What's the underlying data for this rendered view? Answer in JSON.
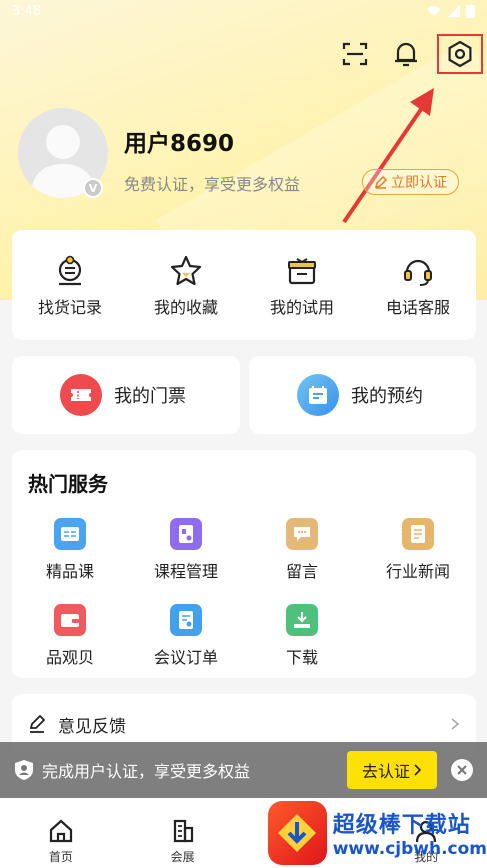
{
  "status_bar": {
    "time": "3:48"
  },
  "user": {
    "name": "用户8690",
    "subtitle": "免费认证，享受更多权益",
    "certify_button": "立即认证",
    "badge": "V"
  },
  "quick_actions": [
    {
      "label": "找货记录",
      "icon": "search-record-icon"
    },
    {
      "label": "我的收藏",
      "icon": "star-icon"
    },
    {
      "label": "我的试用",
      "icon": "gift-box-icon"
    },
    {
      "label": "电话客服",
      "icon": "headset-icon"
    }
  ],
  "tickets": {
    "left_label": "我的门票",
    "right_label": "我的预约"
  },
  "services": {
    "title": "热门服务",
    "items": [
      {
        "label": "精品课",
        "color": "#4aa3f0"
      },
      {
        "label": "课程管理",
        "color": "#8e6cf0"
      },
      {
        "label": "留言",
        "color": "#e4b879"
      },
      {
        "label": "行业新闻",
        "color": "#e7b66e"
      },
      {
        "label": "品观贝",
        "color": "#f0595e"
      },
      {
        "label": "会议订单",
        "color": "#43a0ec"
      },
      {
        "label": "下载",
        "color": "#4fc17c"
      }
    ]
  },
  "feedback": {
    "label": "意见反馈"
  },
  "banner": {
    "text": "完成用户认证，享受更多权益",
    "button": "去认证"
  },
  "tabs": [
    {
      "label": "首页",
      "icon": "home-icon"
    },
    {
      "label": "会展",
      "icon": "building-icon"
    },
    {
      "label": "",
      "icon": ""
    },
    {
      "label": "我的",
      "icon": "profile-icon"
    }
  ],
  "watermark": {
    "title": "超级棒下载站",
    "url": "www.cjbwh.com"
  },
  "colors": {
    "accent": "#ffe100",
    "highlight_box": "#e53935",
    "hero_yellow": "#fff3b0"
  }
}
